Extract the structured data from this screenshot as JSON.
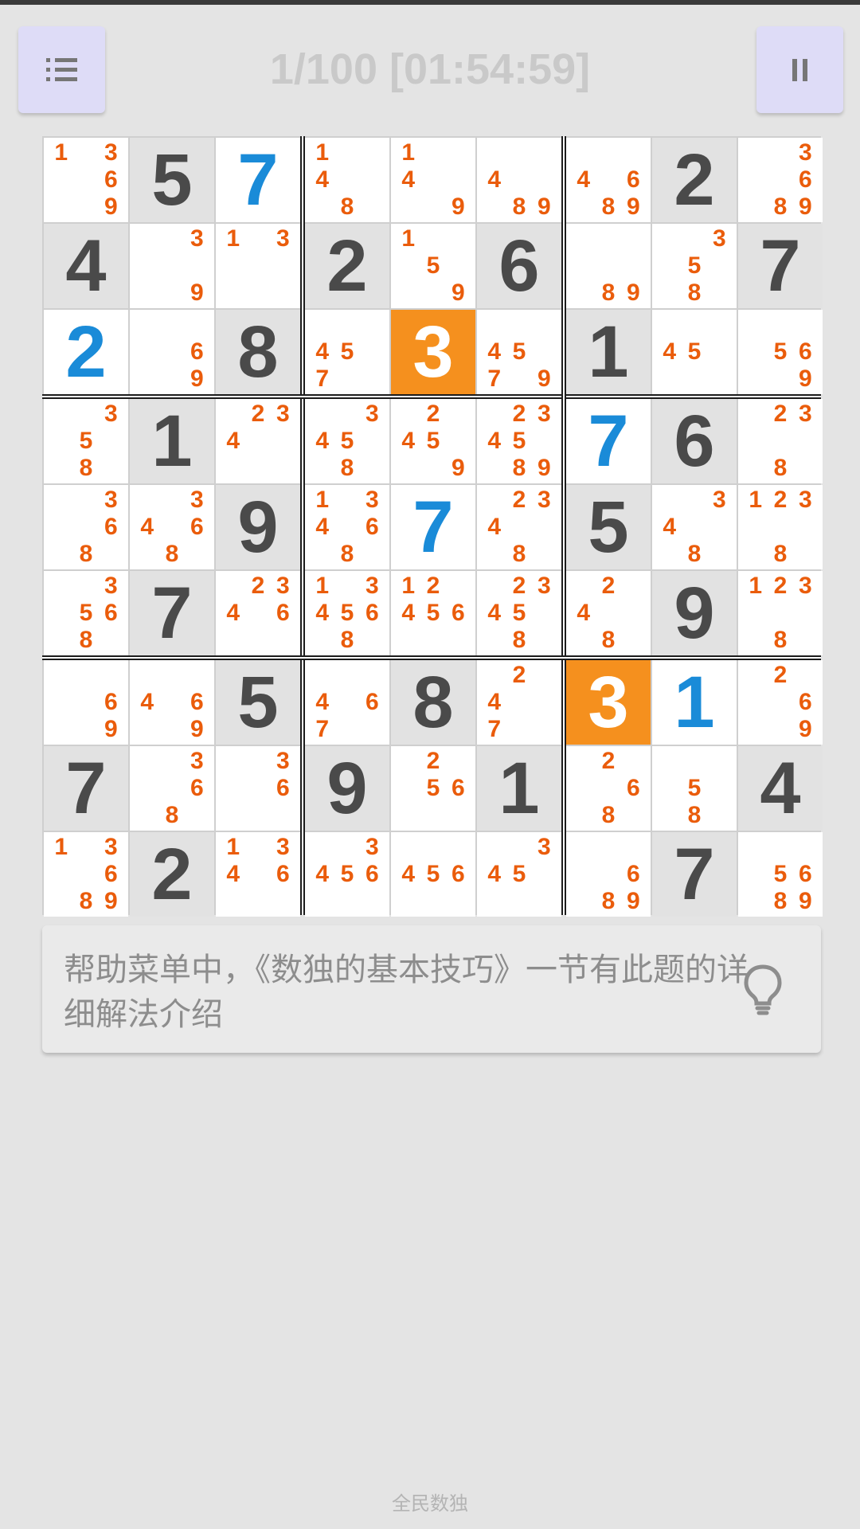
{
  "header": {
    "title": "1/100 [01:54:59]",
    "menu_icon": "list-icon",
    "pause_icon": "pause-icon"
  },
  "colors": {
    "given_digit": "#4a4a4a",
    "user_digit": "#1a8bd8",
    "candidate": "#ea5c0b",
    "highlight": "#f5901e"
  },
  "board": {
    "cells": [
      [
        {
          "c": "1369"
        },
        {
          "g": "5"
        },
        {
          "u": "7"
        },
        {
          "c": "148"
        },
        {
          "c": "149"
        },
        {
          "c": "489"
        },
        {
          "c": "4689"
        },
        {
          "g": "2"
        },
        {
          "c": "3689"
        }
      ],
      [
        {
          "g": "4"
        },
        {
          "c": "39"
        },
        {
          "c": "13"
        },
        {
          "g": "2"
        },
        {
          "c": "159"
        },
        {
          "g": "6"
        },
        {
          "c": "89"
        },
        {
          "c": "358"
        },
        {
          "g": "7"
        }
      ],
      [
        {
          "u": "2"
        },
        {
          "c": "69"
        },
        {
          "g": "8"
        },
        {
          "c": "457"
        },
        {
          "g": "3",
          "h": true
        },
        {
          "c": "4579"
        },
        {
          "g": "1"
        },
        {
          "c": "45"
        },
        {
          "c": "569"
        }
      ],
      [
        {
          "c": "358"
        },
        {
          "g": "1"
        },
        {
          "c": "234"
        },
        {
          "c": "3458"
        },
        {
          "c": "2459"
        },
        {
          "c": "234589"
        },
        {
          "u": "7"
        },
        {
          "g": "6"
        },
        {
          "c": "238"
        }
      ],
      [
        {
          "c": "368"
        },
        {
          "c": "3468"
        },
        {
          "g": "9"
        },
        {
          "c": "13468"
        },
        {
          "u": "7"
        },
        {
          "c": "2348"
        },
        {
          "g": "5"
        },
        {
          "c": "348"
        },
        {
          "c": "1238"
        }
      ],
      [
        {
          "c": "3568"
        },
        {
          "g": "7"
        },
        {
          "c": "2346"
        },
        {
          "c": "134568"
        },
        {
          "c": "12456"
        },
        {
          "c": "23458"
        },
        {
          "c": "248"
        },
        {
          "g": "9"
        },
        {
          "c": "1238"
        }
      ],
      [
        {
          "c": "69"
        },
        {
          "c": "469"
        },
        {
          "g": "5"
        },
        {
          "c": "467"
        },
        {
          "g": "8"
        },
        {
          "c": "247"
        },
        {
          "g": "3",
          "h": true
        },
        {
          "u": "1"
        },
        {
          "c": "269"
        }
      ],
      [
        {
          "g": "7"
        },
        {
          "c": "368"
        },
        {
          "c": "36"
        },
        {
          "g": "9"
        },
        {
          "c": "256"
        },
        {
          "g": "1"
        },
        {
          "c": "268"
        },
        {
          "c": "58"
        },
        {
          "g": "4"
        }
      ],
      [
        {
          "c": "13689"
        },
        {
          "g": "2"
        },
        {
          "c": "1346"
        },
        {
          "c": "3456"
        },
        {
          "c": "456"
        },
        {
          "c": "345"
        },
        {
          "c": "689"
        },
        {
          "g": "7"
        },
        {
          "c": "5689"
        }
      ]
    ]
  },
  "hint": {
    "text": "帮助菜单中，《数独的基本技巧》一节有此题的详细解法介绍",
    "icon": "lightbulb-icon"
  },
  "footer": {
    "text": "全民数独"
  }
}
